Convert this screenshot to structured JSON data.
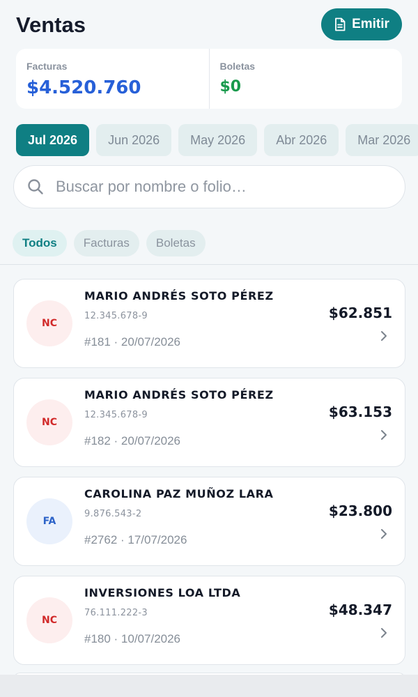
{
  "header": {
    "title": "Ventas",
    "emit_label": "Emitir"
  },
  "summary": {
    "facturas_label": "Facturas",
    "facturas_value": "$4.520.760",
    "boletas_label": "Boletas",
    "boletas_value": "$0"
  },
  "months": [
    "Jul 2026",
    "Jun 2026",
    "May 2026",
    "Abr 2026",
    "Mar 2026"
  ],
  "search": {
    "placeholder": "Buscar por nombre o folio…"
  },
  "filters": [
    "Todos",
    "Facturas",
    "Boletas"
  ],
  "documents": [
    {
      "type": "NC",
      "name": "MARIO ANDRÉS SOTO PÉREZ",
      "rut": "12.345.678-9",
      "meta": "#181 · 20/07/2026",
      "amount": "$62.851"
    },
    {
      "type": "NC",
      "name": "MARIO ANDRÉS SOTO PÉREZ",
      "rut": "12.345.678-9",
      "meta": "#182 · 20/07/2026",
      "amount": "$63.153"
    },
    {
      "type": "FA",
      "name": "CAROLINA PAZ MUÑOZ LARA",
      "rut": "9.876.543-2",
      "meta": "#2762 · 17/07/2026",
      "amount": "$23.800"
    },
    {
      "type": "NC",
      "name": "INVERSIONES LOA LTDA",
      "rut": "76.111.222-3",
      "meta": "#180 · 10/07/2026",
      "amount": "$48.347"
    }
  ],
  "colors": {
    "accent": "#0f7f83",
    "facturas": "#2760d8",
    "boletas": "#1a9a4d",
    "nc": "#d12a2a",
    "fa": "#2d63c8"
  },
  "icons": {
    "emit": "document-icon",
    "search": "search-icon",
    "row": "chevron-right-icon"
  }
}
